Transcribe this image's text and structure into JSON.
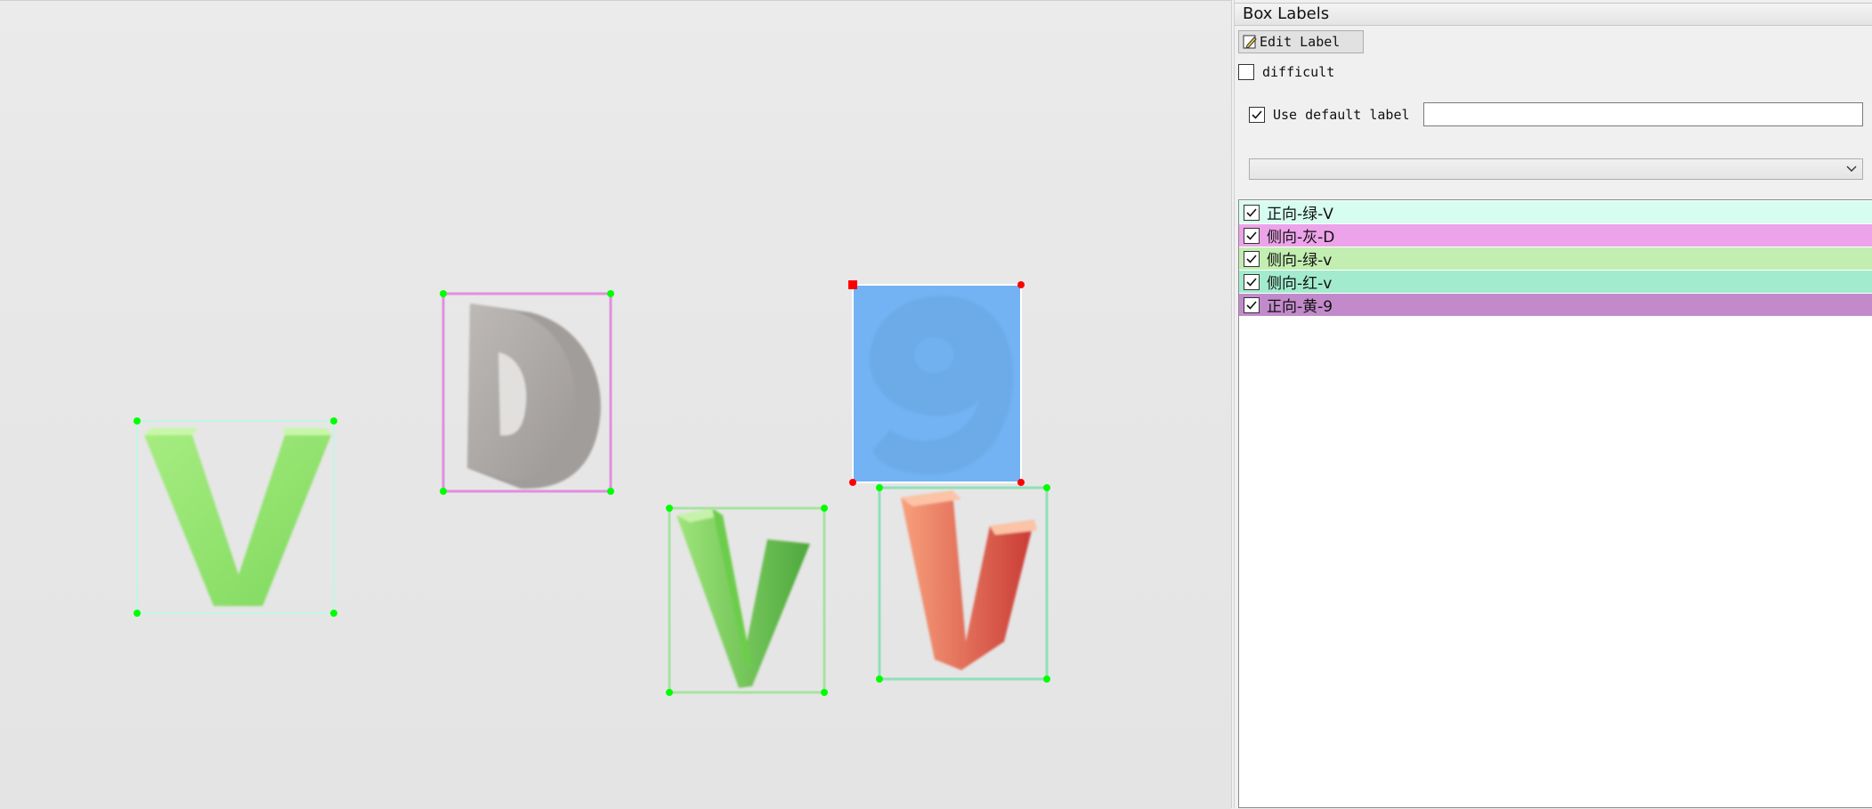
{
  "canvas": {
    "background": "#e6e6e6"
  },
  "dock": {
    "title": "Box Labels",
    "edit_label_button": "Edit Label",
    "difficult_label": "difficult",
    "difficult_checked": false,
    "use_default_label": "Use default label",
    "use_default_checked": true,
    "default_label_value": "",
    "label_combo_value": ""
  },
  "labels": [
    {
      "text": "正向-绿-V",
      "color": "#d6fdf0",
      "checked": true
    },
    {
      "text": "侧向-灰-D",
      "color": "#eca3e9",
      "checked": true
    },
    {
      "text": "侧向-绿-v",
      "color": "#c2eeb1",
      "checked": true
    },
    {
      "text": "侧向-红-v",
      "color": "#a2ebcf",
      "checked": true
    },
    {
      "text": "正向-黄-9",
      "color": "#c28acb",
      "checked": true
    }
  ],
  "boxes": [
    {
      "label": "正向-绿-V",
      "stroke": "#c3f5e6",
      "selected": false
    },
    {
      "label": "侧向-灰-D",
      "stroke": "#e08fe0",
      "selected": false
    },
    {
      "label": "侧向-绿-v",
      "stroke": "#a8e3a0",
      "selected": false
    },
    {
      "label": "侧向-红-v",
      "stroke": "#8fe0b8",
      "selected": false
    },
    {
      "label": "正向-黄-9",
      "stroke": "#ffffff",
      "fill": "#5ea9f5",
      "selected": true
    }
  ],
  "glyphs": [
    "V",
    "D",
    "V",
    "V",
    "9"
  ],
  "colors": {
    "vertex": "#00ff00",
    "selected_vertex": "#ff0000"
  }
}
